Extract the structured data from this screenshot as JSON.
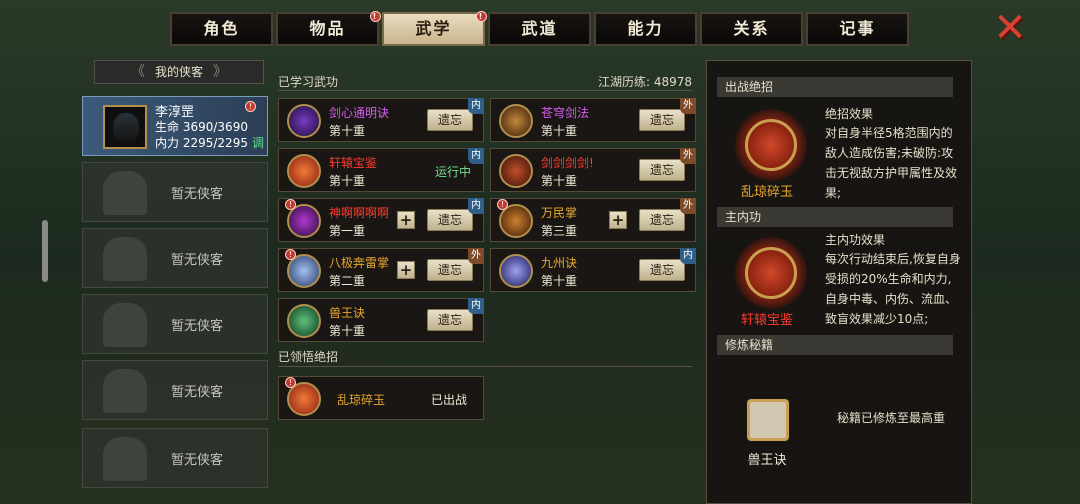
{
  "tabs": [
    {
      "label": "角色",
      "badge": ""
    },
    {
      "label": "物品",
      "badge": "!"
    },
    {
      "label": "武学",
      "badge": "!",
      "active": true
    },
    {
      "label": "武道",
      "badge": ""
    },
    {
      "label": "能力",
      "badge": ""
    },
    {
      "label": "关系",
      "badge": ""
    },
    {
      "label": "记事",
      "badge": ""
    }
  ],
  "close_icon": "close-x-icon",
  "left": {
    "title": "我的侠客",
    "arrow_left": "《",
    "arrow_right": "》",
    "hero": {
      "name": "李淳罡",
      "hp_label": "生命",
      "hp": "3690/3690",
      "mp_label": "内力",
      "mp": "2295/2295",
      "tune": "调",
      "badge": "!"
    },
    "empty_label": "暂无侠客"
  },
  "mid": {
    "learned_title": "已学习武功",
    "exp_label": "江湖历练:",
    "exp_value": "48978",
    "comprehended_title": "已领悟绝招",
    "skills": [
      {
        "name": "剑心通明诀",
        "level": "第十重",
        "tag": "内",
        "action": "遗忘",
        "color": "#d45cf0"
      },
      {
        "name": "苍穹剑法",
        "level": "第十重",
        "tag": "外",
        "action": "遗忘",
        "color": "#d45cf0"
      },
      {
        "name": "轩辕宝鉴",
        "level": "第十重",
        "tag": "内",
        "status": "运行中",
        "color": "#ff3a30"
      },
      {
        "name": "剑剑剑剑!",
        "level": "第十重",
        "tag": "外",
        "action": "遗忘",
        "color": "#ff3a30"
      },
      {
        "name": "神啊啊啊啊",
        "level": "第一重",
        "tag": "内",
        "action": "遗忘",
        "plus": "+",
        "color": "#ff3a30",
        "badge": "!"
      },
      {
        "name": "万民掌",
        "level": "第三重",
        "tag": "外",
        "action": "遗忘",
        "plus": "+",
        "color": "#e8a830",
        "badge": "!"
      },
      {
        "name": "八极奔雷掌",
        "level": "第二重",
        "tag": "外",
        "action": "遗忘",
        "plus": "+",
        "color": "#e8a830",
        "badge": "!"
      },
      {
        "name": "九州诀",
        "level": "第十重",
        "tag": "内",
        "action": "遗忘",
        "color": "#e8a830"
      },
      {
        "name": "兽王诀",
        "level": "第十重",
        "tag": "内",
        "action": "遗忘",
        "color": "#e8a830"
      }
    ],
    "ultimate": {
      "name": "乱琼碎玉",
      "status": "已出战",
      "color": "#e8a830",
      "badge": "!"
    }
  },
  "right": {
    "battle_title": "出战绝招",
    "battle_name": "乱琼碎玉",
    "battle_effect_title": "绝招效果",
    "battle_effect_text": "对自身半径5格范围内的敌人造成伤害;未破防:攻击无视敌方护甲属性及效果;",
    "inner_title": "主内功",
    "inner_name": "轩辕宝鉴",
    "inner_effect_title": "主内功效果",
    "inner_effect_text": "每次行动结束后,恢复自身受损的20%生命和内力,自身中毒、内伤、流血、致盲效果减少10点;",
    "manual_title": "修炼秘籍",
    "manual_name": "兽王诀",
    "manual_note": "秘籍已修炼至最高重"
  },
  "colors": {
    "accent": "#c8a050",
    "active_tab": "#d8c9a4",
    "inner_tag": "#2f5f88",
    "outer_tag": "#7d4a2a",
    "running": "#70e090"
  }
}
